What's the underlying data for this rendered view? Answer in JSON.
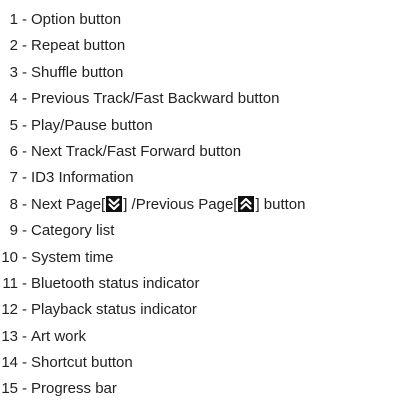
{
  "items": [
    {
      "num": "1",
      "label": "Option button"
    },
    {
      "num": "2",
      "label": "Repeat button"
    },
    {
      "num": "3",
      "label": "Shuffle button"
    },
    {
      "num": "4",
      "label": "Previous Track/Fast Backward button"
    },
    {
      "num": "5",
      "label": "Play/Pause button"
    },
    {
      "num": "6",
      "label": "Next Track/Fast Forward button"
    },
    {
      "num": "7",
      "label": "ID3 Information"
    },
    {
      "num": "8",
      "label_part1": "Next Page[",
      "label_part2": "] /Previous Page[",
      "label_part3": "] button",
      "icons": [
        "double-chevron-down-icon",
        "double-chevron-up-icon"
      ]
    },
    {
      "num": "9",
      "label": "Category list"
    },
    {
      "num": "10",
      "label": "System time"
    },
    {
      "num": "11",
      "label": "Bluetooth status indicator"
    },
    {
      "num": "12",
      "label": "Playback status indicator"
    },
    {
      "num": "13",
      "label": "Art work"
    },
    {
      "num": "14",
      "label": "Shortcut button"
    },
    {
      "num": "15",
      "label": "Progress bar"
    }
  ],
  "separator": "-",
  "colors": {
    "text": "#222222",
    "icon_bg": "#111111",
    "icon_fg": "#ffffff"
  }
}
